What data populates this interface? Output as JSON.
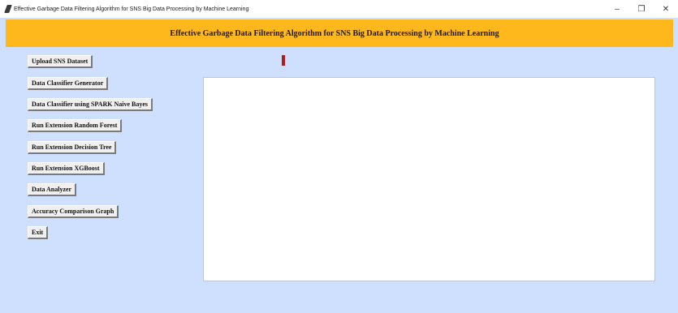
{
  "window": {
    "title": "Effective Garbage Data Filtering Algorithm for SNS Big Data Processing by Machine Learning",
    "controls": {
      "minimize": "–",
      "restore": "❐",
      "close": "✕"
    },
    "app_icon": "feather-icon"
  },
  "header": {
    "title": "Effective Garbage Data Filtering Algorithm for SNS Big Data Processing by Machine Learning"
  },
  "buttons": [
    {
      "label": "Upload SNS Dataset"
    },
    {
      "label": "Data Classifier Generator"
    },
    {
      "label": "Data Classifier using SPARK Naive Bayes"
    },
    {
      "label": "Run Extension Random Forest"
    },
    {
      "label": "Run Extension Decision Tree"
    },
    {
      "label": "Run Extension XGBoost"
    },
    {
      "label": "Data Analyzer"
    },
    {
      "label": "Accuracy Comparison Graph"
    },
    {
      "label": "Exit"
    }
  ],
  "output_text": "",
  "colors": {
    "background": "#cfe0ff",
    "header": "#ffb81c",
    "indicator": "#b31b1b",
    "output": "#ffffff"
  }
}
